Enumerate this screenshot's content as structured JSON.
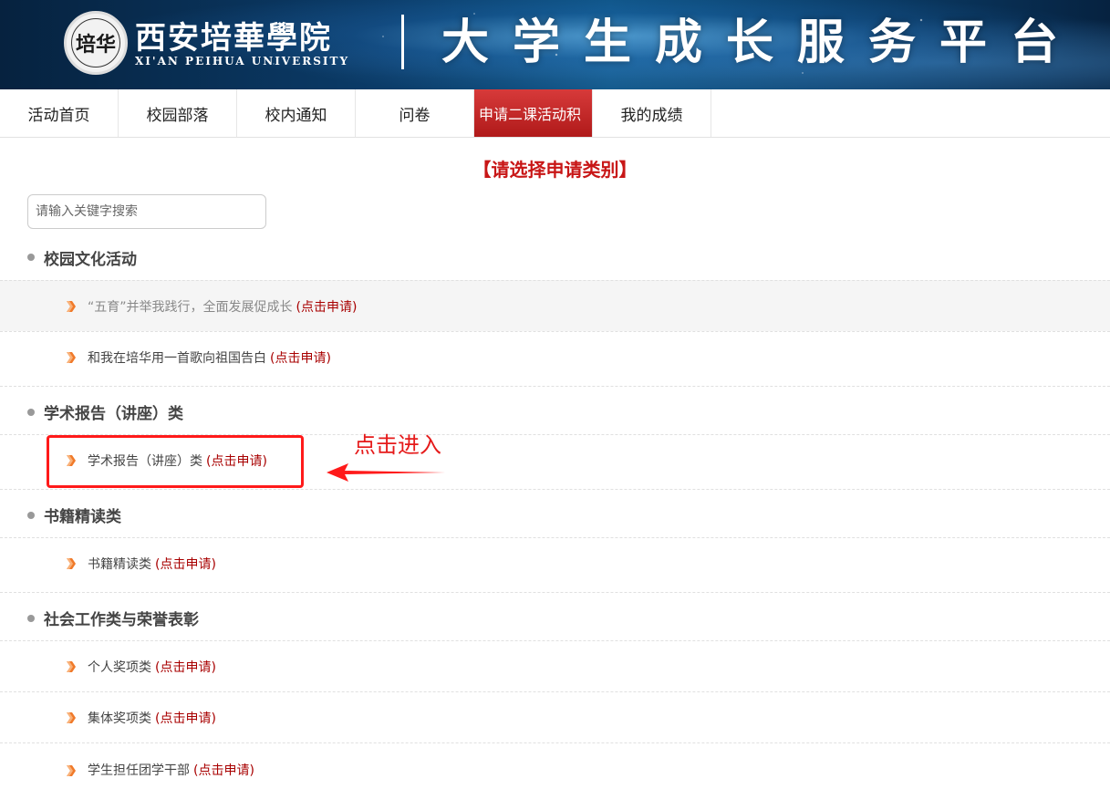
{
  "banner": {
    "school_name_cn": "西安培華學院",
    "school_name_en": "XI'AN PEIHUA UNIVERSITY",
    "seal_text": "培华",
    "platform_name": "大学生成长服务平台"
  },
  "nav": {
    "items": [
      {
        "label": "活动首页"
      },
      {
        "label": "校园部落"
      },
      {
        "label": "校内通知"
      },
      {
        "label": "问卷"
      },
      {
        "label": "申请二课活动积",
        "active": true
      },
      {
        "label": "我的成绩"
      }
    ],
    "active_color": "#c62828"
  },
  "page_title": "【请选择申请类别】",
  "search": {
    "placeholder": "请输入关键字搜索",
    "value": ""
  },
  "apply_label": "(点击申请)",
  "categories": [
    {
      "title": "校园文化活动",
      "items": [
        {
          "label": "“五育”并举我践行，全面发展促成长"
        },
        {
          "label": "和我在培华用一首歌向祖国告白"
        }
      ]
    },
    {
      "title": "学术报告（讲座）类",
      "items": [
        {
          "label": "学术报告（讲座）类"
        }
      ]
    },
    {
      "title": "书籍精读类",
      "items": [
        {
          "label": "书籍精读类"
        }
      ]
    },
    {
      "title": "社会工作类与荣誉表彰",
      "items": [
        {
          "label": "个人奖项类"
        },
        {
          "label": "集体奖项类"
        },
        {
          "label": "学生担任团学干部"
        }
      ]
    }
  ],
  "annotation": {
    "hint": "点击进入",
    "color": "#ff1a1a"
  },
  "icons": {
    "bullet": "bullet-dot-icon",
    "item": "orange-arrow-icon"
  }
}
